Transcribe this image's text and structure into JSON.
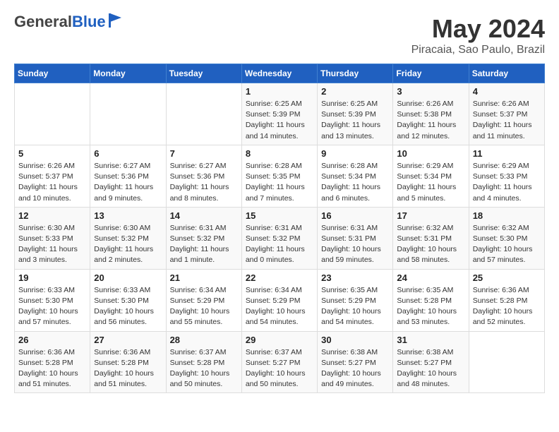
{
  "header": {
    "logo_general": "General",
    "logo_blue": "Blue",
    "main_title": "May 2024",
    "subtitle": "Piracaia, Sao Paulo, Brazil"
  },
  "calendar": {
    "weekdays": [
      "Sunday",
      "Monday",
      "Tuesday",
      "Wednesday",
      "Thursday",
      "Friday",
      "Saturday"
    ],
    "weeks": [
      [
        {
          "day": "",
          "info": ""
        },
        {
          "day": "",
          "info": ""
        },
        {
          "day": "",
          "info": ""
        },
        {
          "day": "1",
          "info": "Sunrise: 6:25 AM\nSunset: 5:39 PM\nDaylight: 11 hours\nand 14 minutes."
        },
        {
          "day": "2",
          "info": "Sunrise: 6:25 AM\nSunset: 5:39 PM\nDaylight: 11 hours\nand 13 minutes."
        },
        {
          "day": "3",
          "info": "Sunrise: 6:26 AM\nSunset: 5:38 PM\nDaylight: 11 hours\nand 12 minutes."
        },
        {
          "day": "4",
          "info": "Sunrise: 6:26 AM\nSunset: 5:37 PM\nDaylight: 11 hours\nand 11 minutes."
        }
      ],
      [
        {
          "day": "5",
          "info": "Sunrise: 6:26 AM\nSunset: 5:37 PM\nDaylight: 11 hours\nand 10 minutes."
        },
        {
          "day": "6",
          "info": "Sunrise: 6:27 AM\nSunset: 5:36 PM\nDaylight: 11 hours\nand 9 minutes."
        },
        {
          "day": "7",
          "info": "Sunrise: 6:27 AM\nSunset: 5:36 PM\nDaylight: 11 hours\nand 8 minutes."
        },
        {
          "day": "8",
          "info": "Sunrise: 6:28 AM\nSunset: 5:35 PM\nDaylight: 11 hours\nand 7 minutes."
        },
        {
          "day": "9",
          "info": "Sunrise: 6:28 AM\nSunset: 5:34 PM\nDaylight: 11 hours\nand 6 minutes."
        },
        {
          "day": "10",
          "info": "Sunrise: 6:29 AM\nSunset: 5:34 PM\nDaylight: 11 hours\nand 5 minutes."
        },
        {
          "day": "11",
          "info": "Sunrise: 6:29 AM\nSunset: 5:33 PM\nDaylight: 11 hours\nand 4 minutes."
        }
      ],
      [
        {
          "day": "12",
          "info": "Sunrise: 6:30 AM\nSunset: 5:33 PM\nDaylight: 11 hours\nand 3 minutes."
        },
        {
          "day": "13",
          "info": "Sunrise: 6:30 AM\nSunset: 5:32 PM\nDaylight: 11 hours\nand 2 minutes."
        },
        {
          "day": "14",
          "info": "Sunrise: 6:31 AM\nSunset: 5:32 PM\nDaylight: 11 hours\nand 1 minute."
        },
        {
          "day": "15",
          "info": "Sunrise: 6:31 AM\nSunset: 5:32 PM\nDaylight: 11 hours\nand 0 minutes."
        },
        {
          "day": "16",
          "info": "Sunrise: 6:31 AM\nSunset: 5:31 PM\nDaylight: 10 hours\nand 59 minutes."
        },
        {
          "day": "17",
          "info": "Sunrise: 6:32 AM\nSunset: 5:31 PM\nDaylight: 10 hours\nand 58 minutes."
        },
        {
          "day": "18",
          "info": "Sunrise: 6:32 AM\nSunset: 5:30 PM\nDaylight: 10 hours\nand 57 minutes."
        }
      ],
      [
        {
          "day": "19",
          "info": "Sunrise: 6:33 AM\nSunset: 5:30 PM\nDaylight: 10 hours\nand 57 minutes."
        },
        {
          "day": "20",
          "info": "Sunrise: 6:33 AM\nSunset: 5:30 PM\nDaylight: 10 hours\nand 56 minutes."
        },
        {
          "day": "21",
          "info": "Sunrise: 6:34 AM\nSunset: 5:29 PM\nDaylight: 10 hours\nand 55 minutes."
        },
        {
          "day": "22",
          "info": "Sunrise: 6:34 AM\nSunset: 5:29 PM\nDaylight: 10 hours\nand 54 minutes."
        },
        {
          "day": "23",
          "info": "Sunrise: 6:35 AM\nSunset: 5:29 PM\nDaylight: 10 hours\nand 54 minutes."
        },
        {
          "day": "24",
          "info": "Sunrise: 6:35 AM\nSunset: 5:28 PM\nDaylight: 10 hours\nand 53 minutes."
        },
        {
          "day": "25",
          "info": "Sunrise: 6:36 AM\nSunset: 5:28 PM\nDaylight: 10 hours\nand 52 minutes."
        }
      ],
      [
        {
          "day": "26",
          "info": "Sunrise: 6:36 AM\nSunset: 5:28 PM\nDaylight: 10 hours\nand 51 minutes."
        },
        {
          "day": "27",
          "info": "Sunrise: 6:36 AM\nSunset: 5:28 PM\nDaylight: 10 hours\nand 51 minutes."
        },
        {
          "day": "28",
          "info": "Sunrise: 6:37 AM\nSunset: 5:28 PM\nDaylight: 10 hours\nand 50 minutes."
        },
        {
          "day": "29",
          "info": "Sunrise: 6:37 AM\nSunset: 5:27 PM\nDaylight: 10 hours\nand 50 minutes."
        },
        {
          "day": "30",
          "info": "Sunrise: 6:38 AM\nSunset: 5:27 PM\nDaylight: 10 hours\nand 49 minutes."
        },
        {
          "day": "31",
          "info": "Sunrise: 6:38 AM\nSunset: 5:27 PM\nDaylight: 10 hours\nand 48 minutes."
        },
        {
          "day": "",
          "info": ""
        }
      ]
    ]
  }
}
